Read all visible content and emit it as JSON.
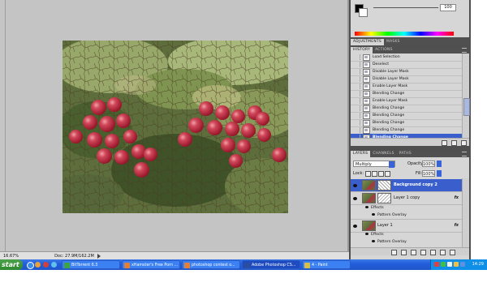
{
  "canvas": {
    "zoom": "16.67%",
    "doc_info": "Doc: 27.9M/162.2M"
  },
  "color_panel": {
    "value": "100",
    "foreground": "#000000",
    "background": "#ffffff"
  },
  "adjust_tabs": [
    "ADJUSTMENTS",
    "MASKS"
  ],
  "history_tabs": [
    "HISTORY",
    "ACTIONS"
  ],
  "history": {
    "items": [
      "Load Selection",
      "Deselect",
      "Disable Layer Mask",
      "Disable Layer Mask",
      "Enable Layer Mask",
      "Blending Change",
      "Enable Layer Mask",
      "Blending Change",
      "Blending Change",
      "Blending Change",
      "Blending Change",
      "Blending Change"
    ]
  },
  "layers_tabs": [
    "LAYERS",
    "CHANNELS",
    "PATHS"
  ],
  "layers": {
    "blend_mode": "Multiply",
    "opacity_label": "Opacity:",
    "opacity": "100%",
    "lock_label": "Lock:",
    "fill_label": "Fill:",
    "fill": "100%",
    "rows": [
      {
        "name": "Background copy 2",
        "fx": ""
      },
      {
        "name": "Layer 1 copy",
        "fx": "fx"
      },
      {
        "name": "Layer 1",
        "fx": "fx"
      }
    ],
    "effects": [
      {
        "label": "Effects"
      },
      {
        "label": "Pattern Overlay"
      },
      {
        "label": "Effects"
      },
      {
        "label": "Pattern Overlay"
      }
    ]
  },
  "taskbar": {
    "start": "start",
    "buttons": [
      "BitTorrent 6.3",
      "xHamster's Free Porn ...",
      "photoshop contest o...",
      "Adobe Photoshop CS...",
      "4 - Paint"
    ],
    "clock": "14:29"
  },
  "colors": {
    "accent": "#3a5fcd",
    "taskbar": "#245edb",
    "start": "#3c9a3c",
    "canvas_bg": "#c4c4c4"
  }
}
